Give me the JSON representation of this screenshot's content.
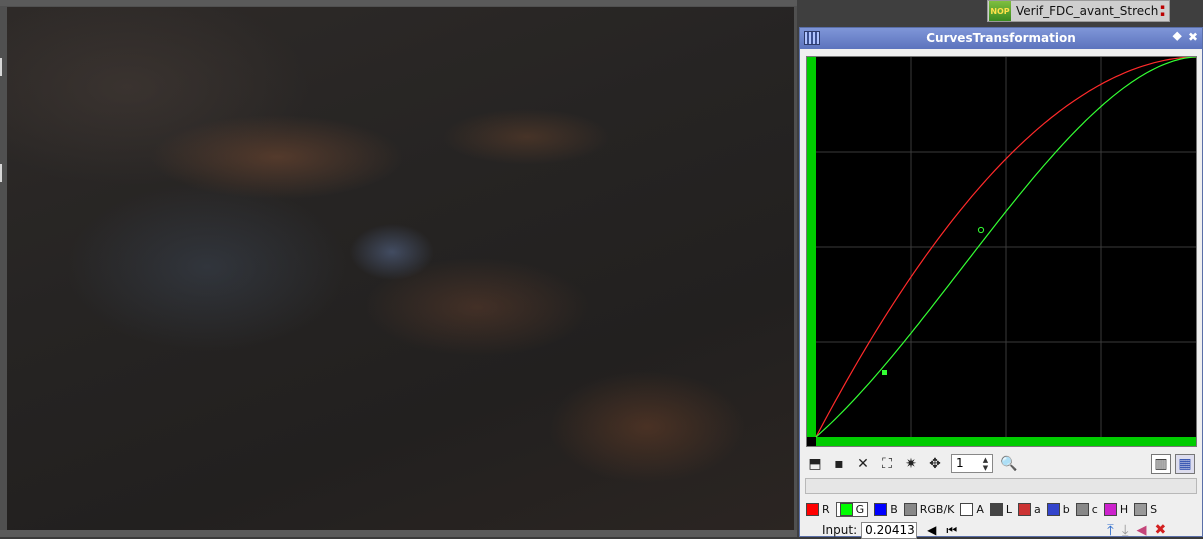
{
  "process_icon": {
    "badge": "NOP",
    "label": "Verif_FDC_avant_Strech"
  },
  "window": {
    "title": "CurvesTransformation",
    "buttons": [
      "✖",
      "✚"
    ]
  },
  "toolbar": {
    "zoom_value": "1"
  },
  "channels": [
    {
      "label": "R",
      "color": "#ff0000",
      "selected": false
    },
    {
      "label": "G",
      "color": "#00ff00",
      "selected": true
    },
    {
      "label": "B",
      "color": "#0000ff",
      "selected": false
    },
    {
      "label": "RGB/K",
      "color": "#888888",
      "selected": false
    },
    {
      "label": "A",
      "color": "#ffffff",
      "selected": false
    },
    {
      "label": "L",
      "color": "#444444",
      "selected": false
    },
    {
      "label": "a",
      "color": "#cc3333",
      "selected": false
    },
    {
      "label": "b",
      "color": "#3344cc",
      "selected": false
    },
    {
      "label": "c",
      "color": "#888888",
      "selected": false
    },
    {
      "label": "H",
      "color": "#cc22cc",
      "selected": false
    },
    {
      "label": "S",
      "color": "#999999",
      "selected": false
    }
  ],
  "input": {
    "label": "Input:",
    "value": "0.20413"
  },
  "curve_colors": {
    "red": "#ff2a2a",
    "green": "#33ff33",
    "grid": "#3a3a3a",
    "axis_bar": "#00cc00"
  }
}
